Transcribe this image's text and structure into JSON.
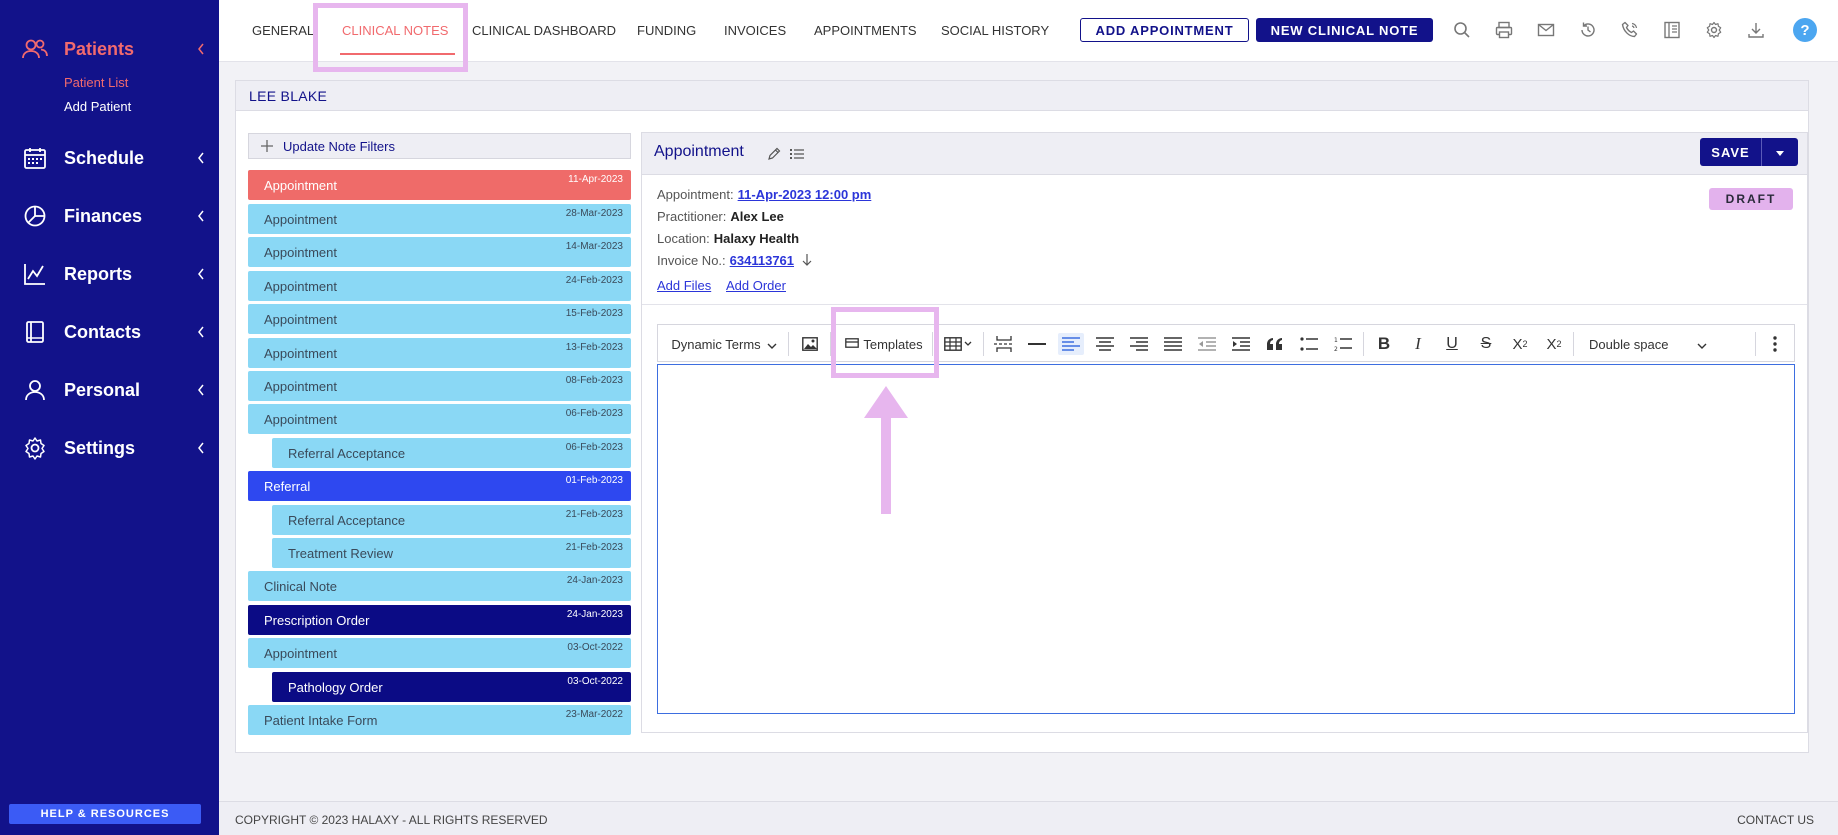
{
  "sidebar": {
    "nav": [
      {
        "label": "Patients",
        "icon": "patients-icon"
      },
      {
        "label": "Schedule",
        "icon": "calendar-icon"
      },
      {
        "label": "Finances",
        "icon": "pie-chart-icon"
      },
      {
        "label": "Reports",
        "icon": "line-chart-icon"
      },
      {
        "label": "Contacts",
        "icon": "address-book-icon"
      },
      {
        "label": "Personal",
        "icon": "person-icon"
      },
      {
        "label": "Settings",
        "icon": "gear-icon"
      }
    ],
    "subnav": {
      "patient_list": "Patient List",
      "add_patient": "Add Patient"
    },
    "help_label": "HELP & RESOURCES"
  },
  "tabs": [
    "GENERAL",
    "CLINICAL NOTES",
    "CLINICAL DASHBOARD",
    "FUNDING",
    "INVOICES",
    "APPOINTMENTS",
    "SOCIAL HISTORY"
  ],
  "active_tab": "CLINICAL NOTES",
  "actions": {
    "add_appointment": "ADD APPOINTMENT",
    "new_clinical_note": "NEW CLINICAL NOTE",
    "help": "?"
  },
  "patient": {
    "name": "LEE BLAKE"
  },
  "filter_label": "Update Note Filters",
  "notes": [
    {
      "title": "Appointment",
      "date": "11-Apr-2023"
    },
    {
      "title": "Appointment",
      "date": "28-Mar-2023"
    },
    {
      "title": "Appointment",
      "date": "14-Mar-2023"
    },
    {
      "title": "Appointment",
      "date": "24-Feb-2023"
    },
    {
      "title": "Appointment",
      "date": "15-Feb-2023"
    },
    {
      "title": "Appointment",
      "date": "13-Feb-2023"
    },
    {
      "title": "Appointment",
      "date": "08-Feb-2023"
    },
    {
      "title": "Appointment",
      "date": "06-Feb-2023"
    },
    {
      "title": "Referral Acceptance",
      "date": "06-Feb-2023"
    },
    {
      "title": "Referral",
      "date": "01-Feb-2023"
    },
    {
      "title": "Referral Acceptance",
      "date": "21-Feb-2023"
    },
    {
      "title": "Treatment Review",
      "date": "21-Feb-2023"
    },
    {
      "title": "Clinical Note",
      "date": "24-Jan-2023"
    },
    {
      "title": "Prescription Order",
      "date": "24-Jan-2023"
    },
    {
      "title": "Appointment",
      "date": "03-Oct-2022"
    },
    {
      "title": "Pathology Order",
      "date": "03-Oct-2022"
    },
    {
      "title": "Patient Intake Form",
      "date": "23-Mar-2022"
    }
  ],
  "colors": {
    "light": "#8ad8f5",
    "selected": "#ef6b69",
    "referral": "#2e48f0",
    "order": "#0b0b85",
    "highlight": "#e7b6ee",
    "brand": "#12128a"
  },
  "editor": {
    "title": "Appointment",
    "save_label": "SAVE",
    "status": "DRAFT",
    "meta": {
      "appointment_label": "Appointment:",
      "appointment_value": "11-Apr-2023 12:00 pm",
      "practitioner_label": "Practitioner:",
      "practitioner_value": "Alex Lee",
      "location_label": "Location:",
      "location_value": "Halaxy Health",
      "invoice_label": "Invoice No.:",
      "invoice_value": "634113761"
    },
    "add_files": "Add Files",
    "add_order": "Add Order",
    "toolbar": {
      "dynamic_terms": "Dynamic Terms",
      "templates": "Templates",
      "line_spacing": "Double space"
    }
  },
  "footer": {
    "copyright": "COPYRIGHT © 2023 HALAXY - ALL RIGHTS RESERVED",
    "contact": "CONTACT US"
  }
}
